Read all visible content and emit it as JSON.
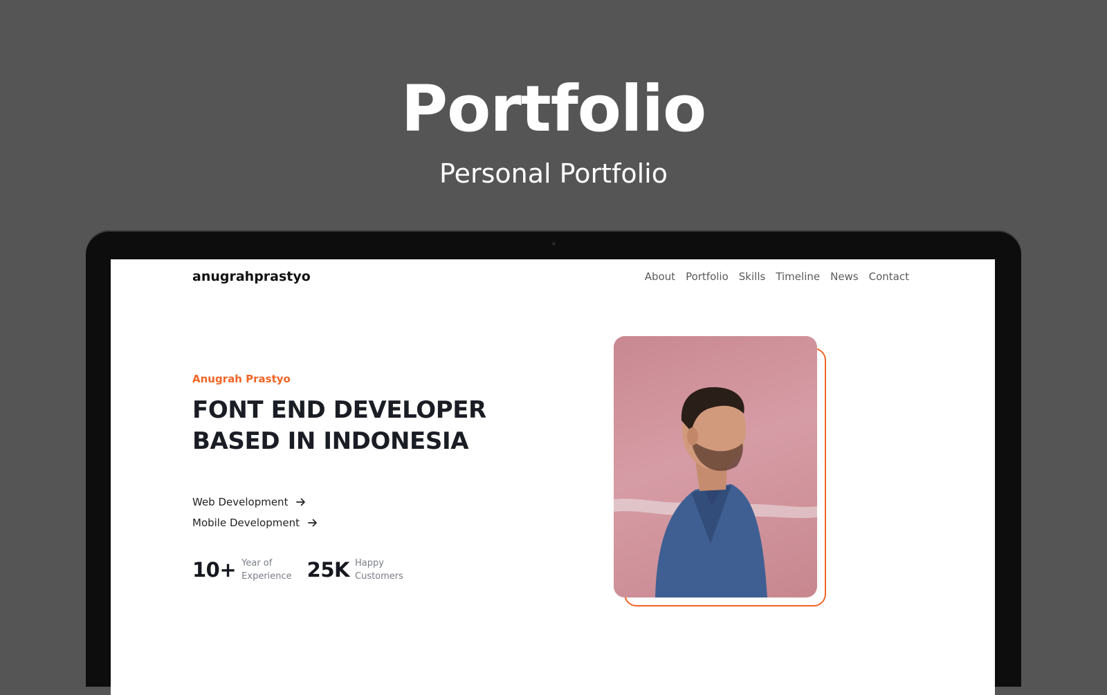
{
  "banner": {
    "title": "Portfolio",
    "subtitle": "Personal Portfolio"
  },
  "site": {
    "logo": "anugrahprastyo",
    "nav": [
      "About",
      "Portfolio",
      "Skills",
      "Timeline",
      "News",
      "Contact"
    ]
  },
  "hero": {
    "eyebrow": "Anugrah Prastyo",
    "headline_line1": "FONT END DEVELOPER",
    "headline_line2": "BASED IN INDONESIA",
    "services": [
      {
        "label": "Web Development",
        "icon": "arrow-right-icon"
      },
      {
        "label": "Mobile Development",
        "icon": "arrow-right-icon"
      }
    ],
    "stats": [
      {
        "value": "10+",
        "label_line1": "Year of",
        "label_line2": "Experience"
      },
      {
        "value": "25K",
        "label_line1": "Happy",
        "label_line2": "Customers"
      }
    ]
  },
  "colors": {
    "accent": "#f06424",
    "background": "#555555",
    "text_dark": "#1a1d24"
  }
}
